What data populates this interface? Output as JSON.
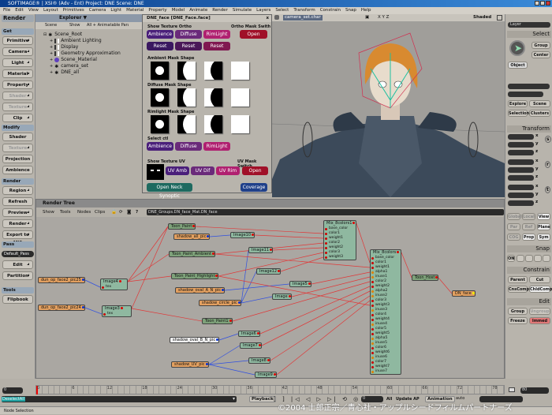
{
  "window": {
    "title": "SOFTIMAGE® | XSI® (Adv - Ent) Project: DNE    Scene: DNE"
  },
  "menu": [
    "File",
    "Edit",
    "View",
    "Layout",
    "Primitives",
    "Camera",
    "Light",
    "Material",
    "Property",
    "Model",
    "Animate",
    "Render",
    "Simulate",
    "Layers",
    "Select",
    "Transform",
    "Constrain",
    "Snap",
    "Help"
  ],
  "left_panel": {
    "title": "Render",
    "get": {
      "label": "Get",
      "buttons": [
        "Primitive",
        "Camera",
        "Light",
        "Material",
        "Property",
        "Shader",
        "Texture",
        "Clip"
      ]
    },
    "modify": {
      "label": "Modify",
      "buttons": [
        "Shader",
        "Texture",
        "Projection",
        "Ambience"
      ]
    },
    "render": {
      "label": "Render",
      "buttons": [
        "Region",
        "Refresh",
        "Preview",
        "Render",
        "Export to MI2"
      ]
    },
    "pass": {
      "label": "Pass",
      "current": "Default_Pass",
      "buttons": [
        "Edit",
        "Partition"
      ]
    },
    "tools": {
      "label": "Tools",
      "buttons": [
        "Flipbook"
      ]
    }
  },
  "explorer": {
    "title": "Explorer",
    "toolbar": [
      "Scene",
      "Show",
      "All + Animatable Parameters"
    ],
    "tree": [
      "Scene_Root",
      "Ambient Lighting",
      "Display",
      "Geometry Approximation",
      "Scene_Material",
      "camera_set",
      "DNE_all"
    ]
  },
  "property_panel": {
    "title": "DNE_face [DNE_Face.face]",
    "show_texture_ortho": "Show Texture Ortho",
    "ortho_mask_switch": "Ortho Mask Swith",
    "ortho_buttons": [
      "Ambience",
      "Diffuse",
      "RimLight"
    ],
    "open": "Open",
    "reset": "Reset",
    "ambient_mask": "Ambient Mask Shape",
    "diffuse_mask": "Diffuse Mask Shape",
    "rimlight_mask": "Rimlight Mask Shape",
    "select_ctl": "Select ctl",
    "select_buttons": [
      "Ambience",
      "Diffuse",
      "RimLight"
    ],
    "show_texture_uv": "Show Texture UV",
    "uv_mask_switch": "UV Mask Switch",
    "uv_buttons": [
      "UV Amb",
      "UV Dif",
      "UV Rim"
    ],
    "open_neck": "Open Neck Synoptic",
    "coverage": "Coverage",
    "colors": {
      "ambience": "#4a1f7a",
      "diffuse": "#6a2a7a",
      "rimlight": "#b02070",
      "open": "#a01028",
      "teal": "#1e6a60",
      "blue": "#20408a"
    }
  },
  "viewport": {
    "camera": "camera_set.char",
    "axes": "X Y Z",
    "mode": "Shaded"
  },
  "right_panel": {
    "layer": "Layer",
    "select": "Select",
    "group": "Group",
    "center": "Center",
    "object": "Object",
    "explore": "Explore",
    "scene": "Scene",
    "selection": "Selection",
    "clusters": "Clusters",
    "transform": "Transform",
    "axes": [
      "x",
      "y",
      "z"
    ],
    "srt": [
      "s",
      "r",
      "t"
    ],
    "modes": [
      "Global",
      "Local",
      "View",
      "Par",
      "Ref",
      "Plane",
      "COG",
      "Prop",
      "Sym"
    ],
    "snap": "Snap",
    "on": "ON",
    "constrain": "Constrain",
    "parent": "Parent",
    "cut": "Cut",
    "cnscomp": "CnsComp",
    "chldcomp": "ChldComp",
    "edit": "Edit",
    "egroup": "Group",
    "ungroup": "Ungroup",
    "freeze": "Freeze",
    "immed": "Immed"
  },
  "render_tree": {
    "title": "Render Tree",
    "menus": [
      "Show",
      "Tools",
      "Nodes",
      "Clips"
    ],
    "path": "DNE_Groups.DN_face_Mat.DN_face",
    "nodes": [
      {
        "id": "Toon_Paint",
        "type": "green"
      },
      {
        "id": "shadow_all_pic",
        "type": "orange"
      },
      {
        "id": "Image10",
        "type": "teal"
      },
      {
        "id": "Toon_Paint_Ambient",
        "type": "green"
      },
      {
        "id": "Image11",
        "type": "teal"
      },
      {
        "id": "Toon_Paint_Highlight",
        "type": "green"
      },
      {
        "id": "Image12",
        "type": "teal"
      },
      {
        "id": "dun_op_face2_pic25",
        "type": "orange"
      },
      {
        "id": "Image4",
        "type": "teal",
        "ports": [
          "tex"
        ]
      },
      {
        "id": "dun_op_face2_pic24",
        "type": "orange"
      },
      {
        "id": "Image3",
        "type": "teal",
        "ports": [
          "tex"
        ]
      },
      {
        "id": "Image5",
        "type": "teal"
      },
      {
        "id": "shadow_oval_A_N_pic",
        "type": "orange"
      },
      {
        "id": "Image",
        "type": "teal"
      },
      {
        "id": "shadow_circle_pic",
        "type": "orange"
      },
      {
        "id": "Toon_Paint1",
        "type": "green"
      },
      {
        "id": "Image6",
        "type": "teal"
      },
      {
        "id": "shadow_oval_B_N_pic",
        "type": "white"
      },
      {
        "id": "Image7",
        "type": "teal"
      },
      {
        "id": "shadow_UV_pic",
        "type": "orange"
      },
      {
        "id": "Image8",
        "type": "teal"
      },
      {
        "id": "Image9",
        "type": "teal"
      },
      {
        "id": "Mix_8colors1",
        "type": "teal",
        "ports": [
          "base_color",
          "color1",
          "weight1",
          "color2",
          "weight2",
          "color3",
          "weight3"
        ]
      },
      {
        "id": "Mix_8colors",
        "type": "teal",
        "ports": [
          "base_color",
          "color1",
          "weight1",
          "alpha1",
          "inuse1",
          "color2",
          "weight2",
          "alpha2",
          "inuse2",
          "color3",
          "weight3",
          "inuse3",
          "color4",
          "weight4",
          "inuse4",
          "color5",
          "weight5",
          "alpha5",
          "inuse5",
          "color6",
          "weight6",
          "inuse6",
          "color7",
          "weight7",
          "inuse7"
        ]
      },
      {
        "id": "Toon_Host",
        "type": "green"
      },
      {
        "id": "DN_face",
        "type": "orange"
      }
    ],
    "connections": [
      [
        "dun_op_face2_pic25",
        "Image4",
        "blue"
      ],
      [
        "dun_op_face2_pic24",
        "Image3",
        "blue"
      ],
      [
        "shadow_all_pic",
        "Image10",
        "blue"
      ],
      [
        "shadow_oval_A_N_pic",
        "Image5",
        "blue"
      ],
      [
        "shadow_circle_pic",
        "Image",
        "blue"
      ],
      [
        "shadow_circle_pic",
        "Image11",
        "blue"
      ],
      [
        "shadow_circle_pic",
        "Image12",
        "blue"
      ],
      [
        "shadow_oval_B_N_pic",
        "Image6",
        "blue"
      ],
      [
        "shadow_UV_pic",
        "Image7",
        "blue"
      ],
      [
        "shadow_UV_pic",
        "Image8",
        "blue"
      ],
      [
        "shadow_UV_pic",
        "Image9",
        "blue"
      ],
      [
        "Image4",
        "Toon_Paint",
        "red"
      ],
      [
        "Image4",
        "Toon_Paint_Ambient",
        "red"
      ],
      [
        "Image4",
        "Toon_Paint_Highlight",
        "red"
      ],
      [
        "Image3",
        "Toon_Paint",
        "red"
      ],
      [
        "Image3",
        "Toon_Paint1",
        "red"
      ],
      [
        "Toon_Paint",
        "Mix_8colors1",
        "red"
      ],
      [
        "Image10",
        "Mix_8colors1",
        "red"
      ],
      [
        "Toon_Paint_Ambient",
        "Mix_8colors1",
        "red"
      ],
      [
        "Image11",
        "Mix_8colors1",
        "red"
      ],
      [
        "Toon_Paint_Highlight",
        "Mix_8colors1",
        "red"
      ],
      [
        "Image12",
        "Mix_8colors1",
        "red"
      ],
      [
        "Mix_8colors1",
        "Mix_8colors",
        "red"
      ],
      [
        "Toon_Paint_Ambient",
        "Mix_8colors",
        "red"
      ],
      [
        "Image5",
        "Mix_8colors",
        "red"
      ],
      [
        "Image",
        "Mix_8colors",
        "red"
      ],
      [
        "Toon_Paint1",
        "Mix_8colors",
        "red"
      ],
      [
        "Image6",
        "Mix_8colors",
        "red"
      ],
      [
        "Image7",
        "Mix_8colors",
        "red"
      ],
      [
        "Image8",
        "Mix_8colors",
        "red"
      ],
      [
        "Image9",
        "Mix_8colors",
        "red"
      ],
      [
        "Toon_Paint_Highlight",
        "Mix_8colors",
        "red"
      ],
      [
        "Mix_8colors",
        "Toon_Host",
        "red"
      ],
      [
        "Toon_Host",
        "DN_face",
        "red"
      ]
    ]
  },
  "timeline": {
    "start": "0",
    "end": "80",
    "current": "0",
    "ticks": [
      "0",
      "6",
      "12",
      "18",
      "24",
      "30",
      "36",
      "42",
      "48",
      "54",
      "60",
      "66",
      "72",
      "78"
    ],
    "command": "DeselectAll",
    "playback": "Playback",
    "all": "All",
    "update": "Update AP",
    "animation": "Animation",
    "auto": "auto",
    "status": "Node Selection",
    "copyright": "©2004 士郎正宗／青心社・アップルシードフィルムパートナーズ"
  }
}
